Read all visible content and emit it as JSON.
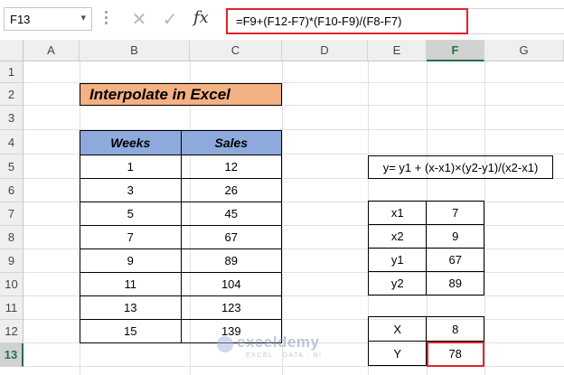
{
  "formula_bar": {
    "name_box": "F13",
    "cancel_glyph": "✕",
    "enter_glyph": "✓",
    "fx_label": "fx",
    "formula": "=F9+(F12-F7)*(F10-F9)/(F8-F7)"
  },
  "columns": [
    "A",
    "B",
    "C",
    "D",
    "E",
    "F",
    "G"
  ],
  "rows": [
    "1",
    "2",
    "3",
    "4",
    "5",
    "6",
    "7",
    "8",
    "9",
    "10",
    "11",
    "12",
    "13"
  ],
  "selected_column": "F",
  "selected_row": "13",
  "title": "Interpolate in Excel",
  "data_table": {
    "headers": [
      "Weeks",
      "Sales"
    ],
    "rows": [
      [
        "1",
        "12"
      ],
      [
        "3",
        "26"
      ],
      [
        "5",
        "45"
      ],
      [
        "7",
        "67"
      ],
      [
        "9",
        "89"
      ],
      [
        "11",
        "104"
      ],
      [
        "13",
        "123"
      ],
      [
        "15",
        "139"
      ]
    ]
  },
  "equation": "y= y1 + (x-x1)×(y2-y1)/(x2-x1)",
  "params": [
    [
      "x1",
      "7"
    ],
    [
      "x2",
      "9"
    ],
    [
      "y1",
      "67"
    ],
    [
      "y2",
      "89"
    ]
  ],
  "result": [
    [
      "X",
      "8"
    ],
    [
      "Y",
      "78"
    ]
  ],
  "watermark": {
    "brand": "exceldemy",
    "tagline": "EXCEL · DATA · BI"
  },
  "colors": {
    "title_fill": "#f4b183",
    "header_fill": "#8ea9db",
    "highlight": "#e0242b",
    "excel_green": "#217346"
  }
}
